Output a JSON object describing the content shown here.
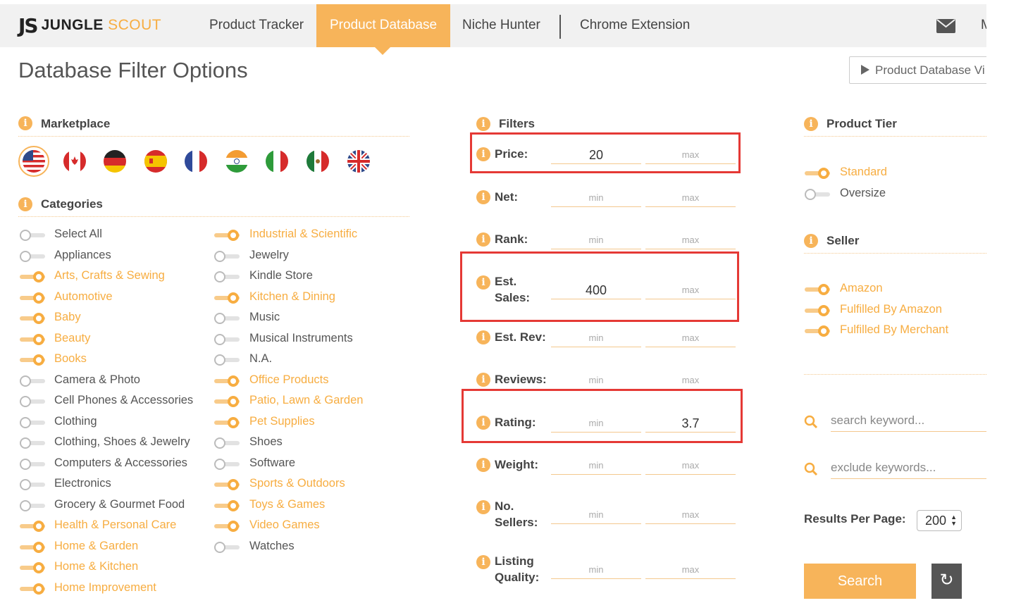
{
  "logo": {
    "js": "JS",
    "jungle": "JUNGLE",
    "scout": "SCOUT"
  },
  "nav": {
    "items": [
      "Product Tracker",
      "Product Database",
      "Niche Hunter",
      "Chrome Extension"
    ],
    "truncated": "M"
  },
  "page_title": "Database Filter Options",
  "video_button": "Product Database Vi",
  "marketplace": {
    "title": "Marketplace",
    "flags": [
      "us-flag-icon",
      "canada-flag-icon",
      "germany-flag-icon",
      "spain-flag-icon",
      "france-flag-icon",
      "india-flag-icon",
      "italy-flag-icon",
      "mexico-flag-icon",
      "uk-flag-icon"
    ],
    "selected": "us-flag-icon"
  },
  "categories": {
    "title": "Categories",
    "left": [
      {
        "label": "Select All",
        "on": false
      },
      {
        "label": "Appliances",
        "on": false
      },
      {
        "label": "Arts, Crafts & Sewing",
        "on": true
      },
      {
        "label": "Automotive",
        "on": true
      },
      {
        "label": "Baby",
        "on": true
      },
      {
        "label": "Beauty",
        "on": true
      },
      {
        "label": "Books",
        "on": true
      },
      {
        "label": "Camera & Photo",
        "on": false
      },
      {
        "label": "Cell Phones & Accessories",
        "on": false
      },
      {
        "label": "Clothing",
        "on": false
      },
      {
        "label": "Clothing, Shoes & Jewelry",
        "on": false
      },
      {
        "label": "Computers & Accessories",
        "on": false
      },
      {
        "label": "Electronics",
        "on": false
      },
      {
        "label": "Grocery & Gourmet Food",
        "on": false
      },
      {
        "label": "Health & Personal Care",
        "on": true
      },
      {
        "label": "Home & Garden",
        "on": true
      },
      {
        "label": "Home & Kitchen",
        "on": true
      },
      {
        "label": "Home Improvement",
        "on": true
      }
    ],
    "right": [
      {
        "label": "Industrial & Scientific",
        "on": true
      },
      {
        "label": "Jewelry",
        "on": false
      },
      {
        "label": "Kindle Store",
        "on": false
      },
      {
        "label": "Kitchen & Dining",
        "on": true
      },
      {
        "label": "Music",
        "on": false
      },
      {
        "label": "Musical Instruments",
        "on": false
      },
      {
        "label": "N.A.",
        "on": false
      },
      {
        "label": "Office Products",
        "on": true
      },
      {
        "label": "Patio, Lawn & Garden",
        "on": true
      },
      {
        "label": "Pet Supplies",
        "on": true
      },
      {
        "label": "Shoes",
        "on": false
      },
      {
        "label": "Software",
        "on": false
      },
      {
        "label": "Sports & Outdoors",
        "on": true
      },
      {
        "label": "Toys & Games",
        "on": true
      },
      {
        "label": "Video Games",
        "on": true
      },
      {
        "label": "Watches",
        "on": false
      }
    ]
  },
  "filters": {
    "title": "Filters",
    "min_placeholder": "min",
    "max_placeholder": "max",
    "rows": [
      {
        "label1": "Price:",
        "label2": "",
        "min": "20",
        "max": "",
        "highlighted": true
      },
      {
        "label1": "Net:",
        "label2": "",
        "min": "",
        "max": "",
        "highlighted": false
      },
      {
        "label1": "Rank:",
        "label2": "",
        "min": "",
        "max": "",
        "highlighted": false
      },
      {
        "label1": "Est.",
        "label2": "Sales:",
        "min": "400",
        "max": "",
        "highlighted": true
      },
      {
        "label1": "Est. Rev:",
        "label2": "",
        "min": "",
        "max": "",
        "highlighted": false
      },
      {
        "label1": "Reviews:",
        "label2": "",
        "min": "",
        "max": "",
        "highlighted": false
      },
      {
        "label1": "Rating:",
        "label2": "",
        "min": "",
        "max": "3.7",
        "highlighted": true
      },
      {
        "label1": "Weight:",
        "label2": "",
        "min": "",
        "max": "",
        "highlighted": false
      },
      {
        "label1": "No.",
        "label2": "Sellers:",
        "min": "",
        "max": "",
        "highlighted": false
      },
      {
        "label1": "Listing",
        "label2": "Quality:",
        "min": "",
        "max": "",
        "highlighted": false
      }
    ]
  },
  "product_tier": {
    "title": "Product Tier",
    "options": [
      {
        "label": "Standard",
        "on": true
      },
      {
        "label": "Oversize",
        "on": false
      }
    ]
  },
  "seller": {
    "title": "Seller",
    "options": [
      {
        "label": "Amazon",
        "on": true
      },
      {
        "label": "Fulfilled By Amazon",
        "on": true
      },
      {
        "label": "Fulfilled By Merchant",
        "on": true
      }
    ]
  },
  "keywords": {
    "search_placeholder": "search keyword...",
    "exclude_placeholder": "exclude keywords..."
  },
  "results": {
    "label": "Results Per Page:",
    "value": "200"
  },
  "buttons": {
    "search": "Search",
    "reset_icon": "↻"
  },
  "colors": {
    "accent": "#f7b45a",
    "highlight_box": "#e53935",
    "text": "#555555"
  }
}
